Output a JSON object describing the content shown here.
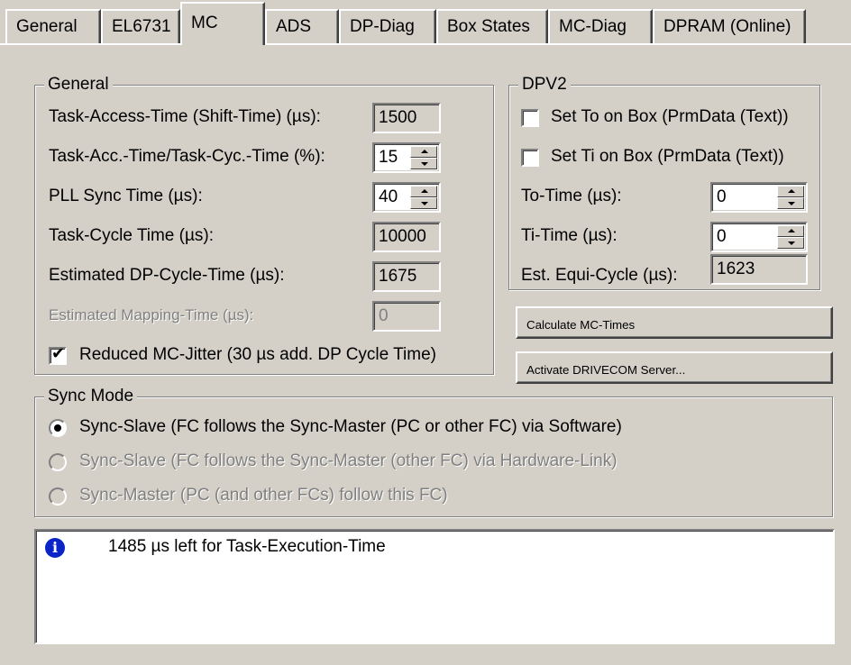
{
  "tabs": [
    "General",
    "EL6731",
    "MC",
    "ADS",
    "DP-Diag",
    "Box States",
    "MC-Diag",
    "DPRAM (Online)"
  ],
  "active_tab": "MC",
  "general": {
    "title": "General",
    "rows": [
      {
        "label": "Task-Access-Time (Shift-Time) (µs):",
        "value": "1500"
      },
      {
        "label": "Task-Acc.-Time/Task-Cyc.-Time (%):",
        "value": "15"
      },
      {
        "label": "PLL Sync Time (µs):",
        "value": "40"
      },
      {
        "label": "Task-Cycle Time (µs):",
        "value": "10000"
      },
      {
        "label": "Estimated DP-Cycle-Time (µs):",
        "value": "1675"
      },
      {
        "label": "Estimated Mapping-Time (µs):",
        "value": "0"
      }
    ],
    "reduced_jitter_label": "Reduced MC-Jitter (30 µs add. DP Cycle Time)",
    "reduced_jitter_checked": true
  },
  "dpv2": {
    "title": "DPV2",
    "set_to_label": "Set To on Box (PrmData (Text))",
    "set_ti_label": "Set Ti on Box (PrmData (Text))",
    "to_time_label": "To-Time (µs):",
    "to_time_value": "0",
    "ti_time_label": "Ti-Time (µs):",
    "ti_time_value": "0",
    "equi_label": "Est. Equi-Cycle (µs):",
    "equi_value": "1623"
  },
  "buttons": {
    "calculate": "Calculate MC-Times",
    "activate": "Activate DRIVECOM Server..."
  },
  "sync_mode": {
    "title": "Sync Mode",
    "options": [
      "Sync-Slave (FC follows the Sync-Master (PC or other FC) via Software)",
      "Sync-Slave (FC follows the Sync-Master (other FC) via Hardware-Link)",
      "Sync-Master (PC (and other FCs) follow this FC)"
    ],
    "selected": 0
  },
  "message": {
    "icon": "info-icon",
    "text": "1485 µs left for Task-Execution-Time"
  },
  "colors": {
    "face": "#d4d0c8",
    "info": "#0a24c8"
  }
}
